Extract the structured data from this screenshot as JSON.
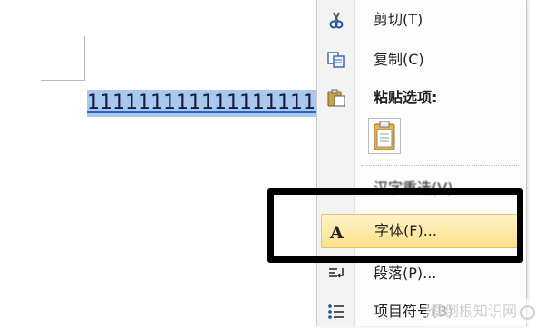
{
  "document": {
    "selected_text": "111111111111111111"
  },
  "context_menu": {
    "cut_label": "剪切(T)",
    "copy_label": "复制(C)",
    "paste_options_label": "粘贴选项:",
    "partial_item_label": "汉字重选(V)",
    "font_label": "字体(F)...",
    "paragraph_label": "段落(P)...",
    "bullets_label": "项目符号(B)",
    "icons": {
      "cut": "scissors-icon",
      "copy": "copy-icon",
      "paste": "clipboard-paste-icon",
      "paste_keep": "clipboard-page-icon",
      "font": "font-a-icon",
      "paragraph": "paragraph-icon",
      "bullets": "bullets-icon"
    }
  },
  "watermark": {
    "text": "爱倒根知识网"
  },
  "colors": {
    "selection": "#a8c8ee",
    "menu_hover": "#fde08a",
    "highlight_frame": "#000000"
  }
}
